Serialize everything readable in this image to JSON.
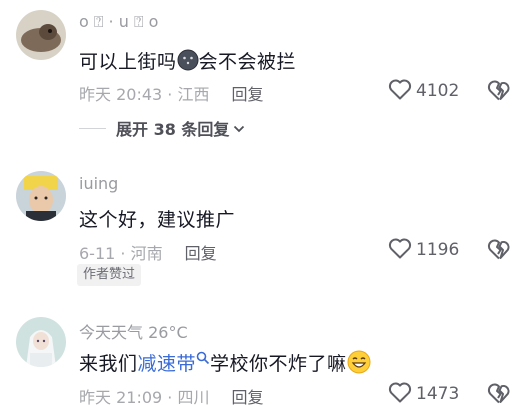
{
  "comments": [
    {
      "username": "o ⍰ · u ⍰   o",
      "text_before": "可以上街吗",
      "text_after": "会不会被拦",
      "time": "昨天 20:43",
      "location": "江西",
      "reply_label": "回复",
      "likes": "4102",
      "expand_label": "展开 38 条回复"
    },
    {
      "username": "iuing",
      "text": "这个好，建议推广",
      "time": "6-11",
      "location": "河南",
      "reply_label": "回复",
      "likes": "1196",
      "badge": "作者赞过"
    },
    {
      "username": "今天天气 26°C",
      "text_before": "来我们",
      "link_text": "减速带",
      "text_after": "学校你不炸了嘛",
      "time": "昨天 21:09",
      "location": "四川",
      "reply_label": "回复",
      "likes": "1473"
    }
  ],
  "colors": {
    "link": "#3a6bd6",
    "meta": "#a7a8ad"
  }
}
